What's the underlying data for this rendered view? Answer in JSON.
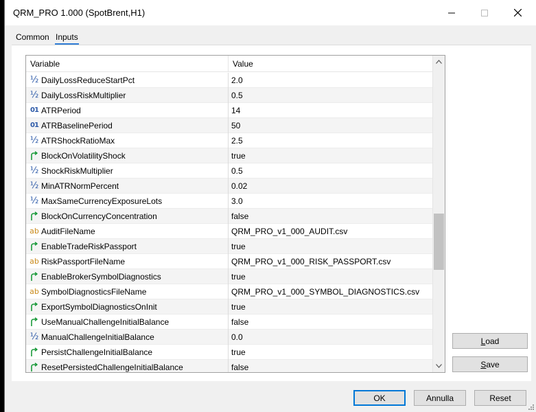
{
  "window": {
    "title": "QRM_PRO 1.000 (SpotBrent,H1)"
  },
  "tabs": [
    {
      "label": "Common",
      "active": false
    },
    {
      "label": "Inputs",
      "active": true
    }
  ],
  "grid": {
    "columns": {
      "variable": "Variable",
      "value": "Value"
    },
    "rows": [
      {
        "icon": "half",
        "name": "DailyLossReduceStartPct",
        "value": "2.0"
      },
      {
        "icon": "half",
        "name": "DailyLossRiskMultiplier",
        "value": "0.5"
      },
      {
        "icon": "int",
        "name": "ATRPeriod",
        "value": "14"
      },
      {
        "icon": "int",
        "name": "ATRBaselinePeriod",
        "value": "50"
      },
      {
        "icon": "half",
        "name": "ATRShockRatioMax",
        "value": "2.5"
      },
      {
        "icon": "bool",
        "name": "BlockOnVolatilityShock",
        "value": "true"
      },
      {
        "icon": "half",
        "name": "ShockRiskMultiplier",
        "value": "0.5"
      },
      {
        "icon": "half",
        "name": "MinATRNormPercent",
        "value": "0.02"
      },
      {
        "icon": "half",
        "name": "MaxSameCurrencyExposureLots",
        "value": "3.0"
      },
      {
        "icon": "bool",
        "name": "BlockOnCurrencyConcentration",
        "value": "false"
      },
      {
        "icon": "str",
        "name": "AuditFileName",
        "value": "QRM_PRO_v1_000_AUDIT.csv"
      },
      {
        "icon": "bool",
        "name": "EnableTradeRiskPassport",
        "value": "true"
      },
      {
        "icon": "str",
        "name": "RiskPassportFileName",
        "value": "QRM_PRO_v1_000_RISK_PASSPORT.csv"
      },
      {
        "icon": "bool",
        "name": "EnableBrokerSymbolDiagnostics",
        "value": "true"
      },
      {
        "icon": "str",
        "name": "SymbolDiagnosticsFileName",
        "value": "QRM_PRO_v1_000_SYMBOL_DIAGNOSTICS.csv"
      },
      {
        "icon": "bool",
        "name": "ExportSymbolDiagnosticsOnInit",
        "value": "true"
      },
      {
        "icon": "bool",
        "name": "UseManualChallengeInitialBalance",
        "value": "false"
      },
      {
        "icon": "half",
        "name": "ManualChallengeInitialBalance",
        "value": "0.0"
      },
      {
        "icon": "bool",
        "name": "PersistChallengeInitialBalance",
        "value": "true"
      },
      {
        "icon": "bool",
        "name": "ResetPersistedChallengeInitialBalance",
        "value": "false"
      }
    ]
  },
  "buttons": {
    "load": {
      "underline": "L",
      "rest": "oad"
    },
    "save": {
      "underline": "S",
      "rest": "ave"
    },
    "ok": "OK",
    "cancel": "Annulla",
    "reset": "Reset"
  },
  "icons": {
    "half": {
      "glyph": "½",
      "color": "#2d5aa8"
    },
    "int": {
      "glyph": "01",
      "color": "#2d5aa8"
    },
    "str": {
      "glyph": "ab",
      "color": "#c98a1a"
    },
    "bool": {
      "glyph": "arrow",
      "color": "#1a9a3a"
    }
  }
}
